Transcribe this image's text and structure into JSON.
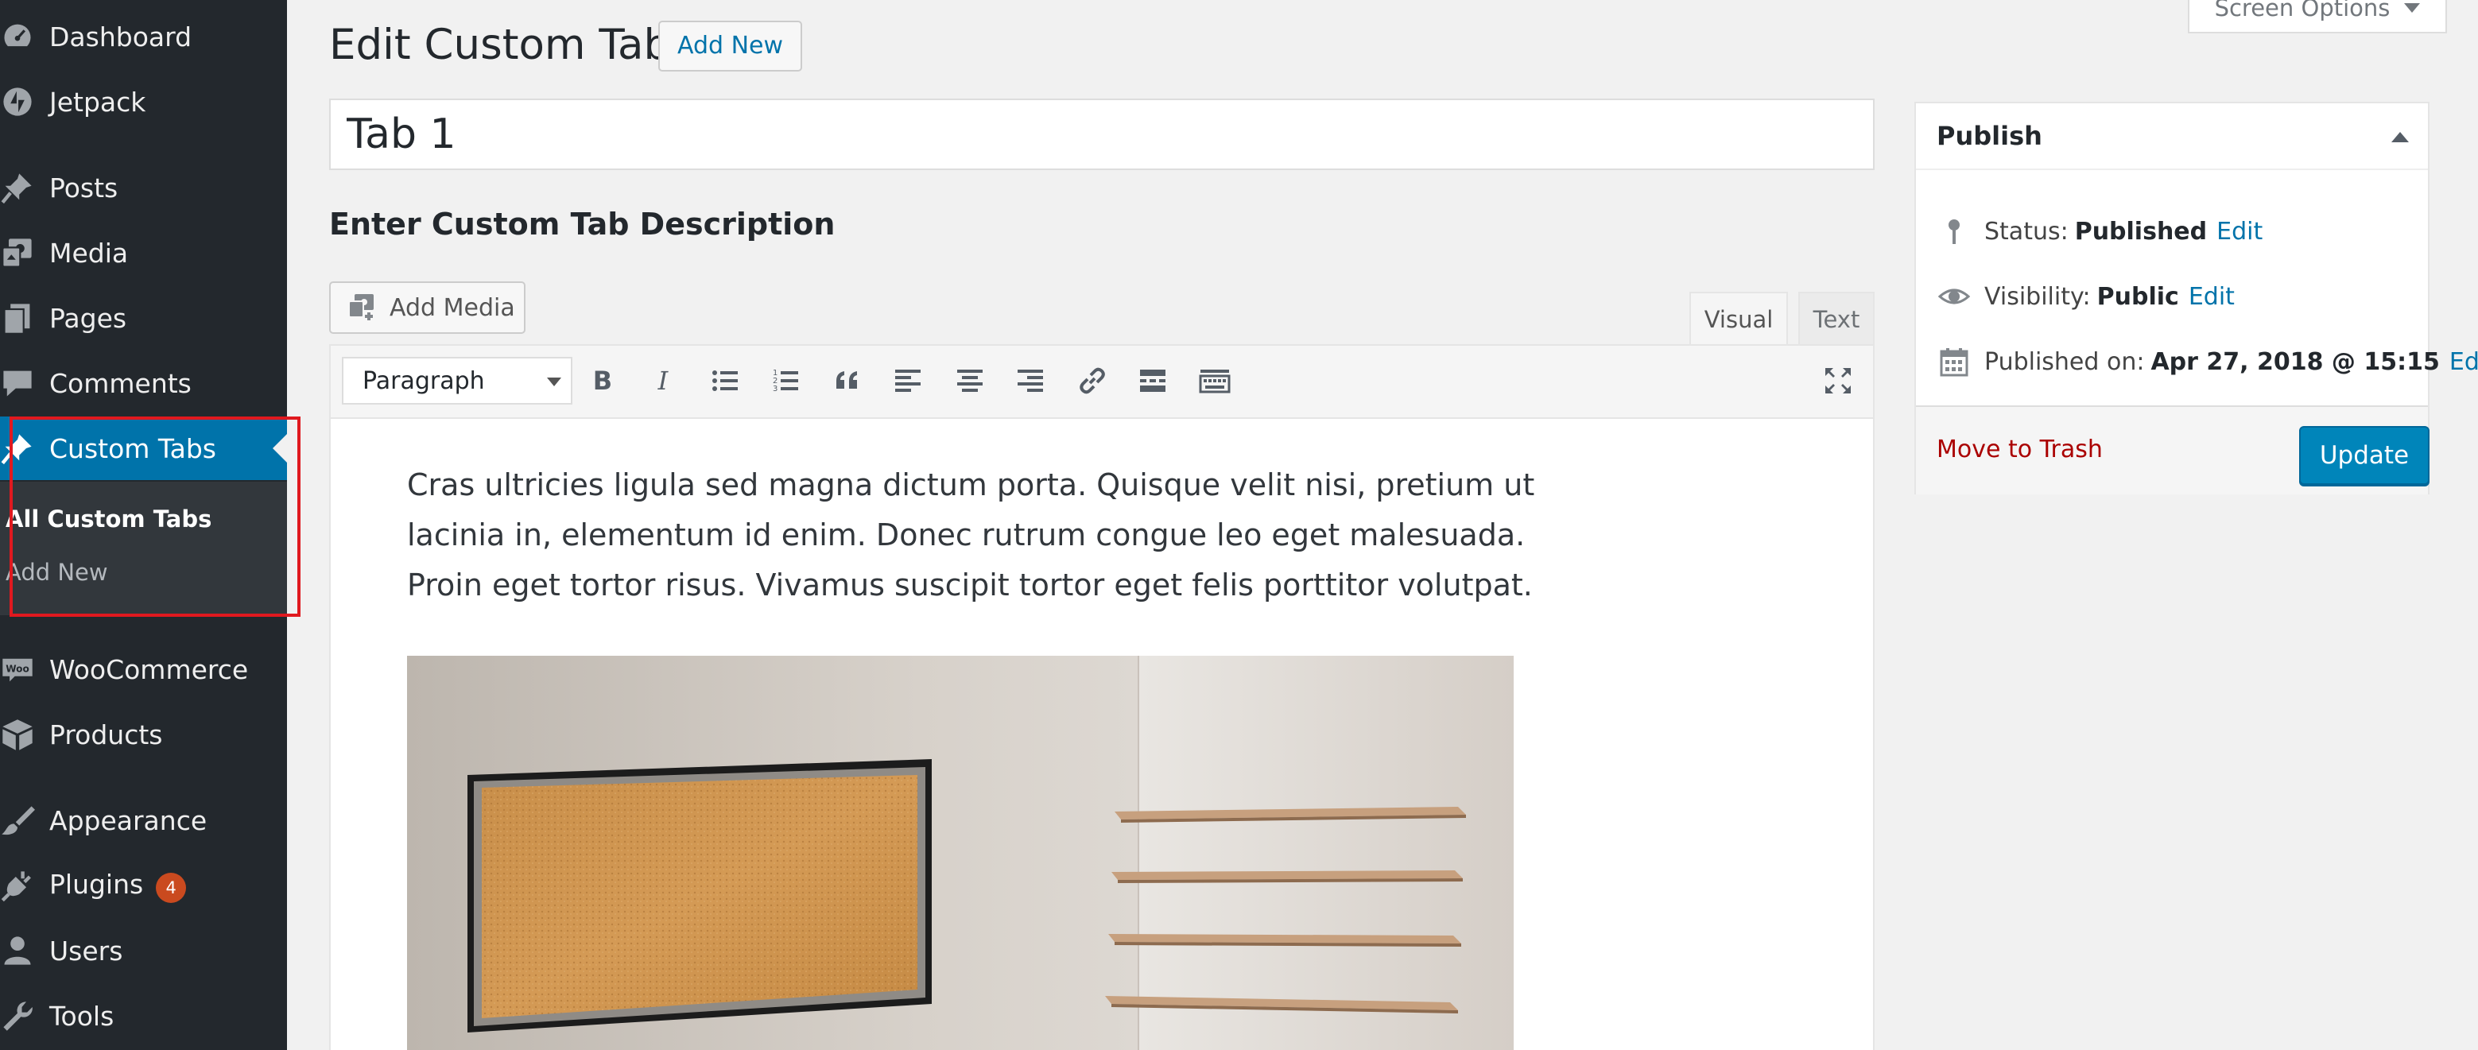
{
  "sidebar": {
    "items": [
      {
        "label": "Dashboard",
        "icon": "dashboard-icon"
      },
      {
        "label": "Jetpack",
        "icon": "jetpack-icon"
      },
      {
        "label": "Posts",
        "icon": "pushpin-icon"
      },
      {
        "label": "Media",
        "icon": "media-icon"
      },
      {
        "label": "Pages",
        "icon": "pages-icon"
      },
      {
        "label": "Comments",
        "icon": "comment-icon"
      },
      {
        "label": "Custom Tabs",
        "icon": "pushpin-icon",
        "active": true
      },
      {
        "label": "WooCommerce",
        "icon": "woocommerce-icon"
      },
      {
        "label": "Products",
        "icon": "box-icon"
      },
      {
        "label": "Appearance",
        "icon": "paintbrush-icon"
      },
      {
        "label": "Plugins",
        "icon": "plug-icon",
        "badge": "4"
      },
      {
        "label": "Users",
        "icon": "user-icon"
      },
      {
        "label": "Tools",
        "icon": "wrench-icon"
      }
    ],
    "submenu": [
      {
        "label": "All Custom Tabs",
        "current": true
      },
      {
        "label": "Add New"
      }
    ]
  },
  "header": {
    "title": "Edit Custom Tab",
    "add_new": "Add New",
    "screen_options": "Screen Options"
  },
  "post": {
    "title_value": "Tab 1",
    "description_heading": "Enter Custom Tab Description"
  },
  "editor": {
    "add_media": "Add Media",
    "tabs": {
      "visual": "Visual",
      "text": "Text"
    },
    "active_tab": "Visual",
    "format_value": "Paragraph",
    "toolbar_icons": [
      "bold-icon",
      "italic-icon",
      "bulleted-list-icon",
      "numbered-list-icon",
      "blockquote-icon",
      "align-left-icon",
      "align-center-icon",
      "align-right-icon",
      "link-icon",
      "read-more-icon",
      "toolbar-toggle-icon",
      "fullscreen-icon"
    ],
    "content": "Cras ultricies ligula sed magna dictum porta. Quisque velit nisi, pretium ut lacinia in, elementum id enim. Donec rutrum congue leo eget malesuada. Proin eget tortor risus. Vivamus suscipit tortor eget felis porttitor volutpat."
  },
  "publish": {
    "heading": "Publish",
    "status_label": "Status:",
    "status_value": "Published",
    "visibility_label": "Visibility:",
    "visibility_value": "Public",
    "published_label": "Published on:",
    "published_value": "Apr 27, 2018 @ 15:15",
    "edit": "Edit",
    "trash": "Move to Trash",
    "update": "Update"
  },
  "colors": {
    "sidebar_bg": "#23282d",
    "active_blue": "#0073aa",
    "update_button": "#0085ba",
    "trash_red": "#aa0000",
    "badge": "#ca4a1f",
    "highlight_box": "#e0191f"
  }
}
